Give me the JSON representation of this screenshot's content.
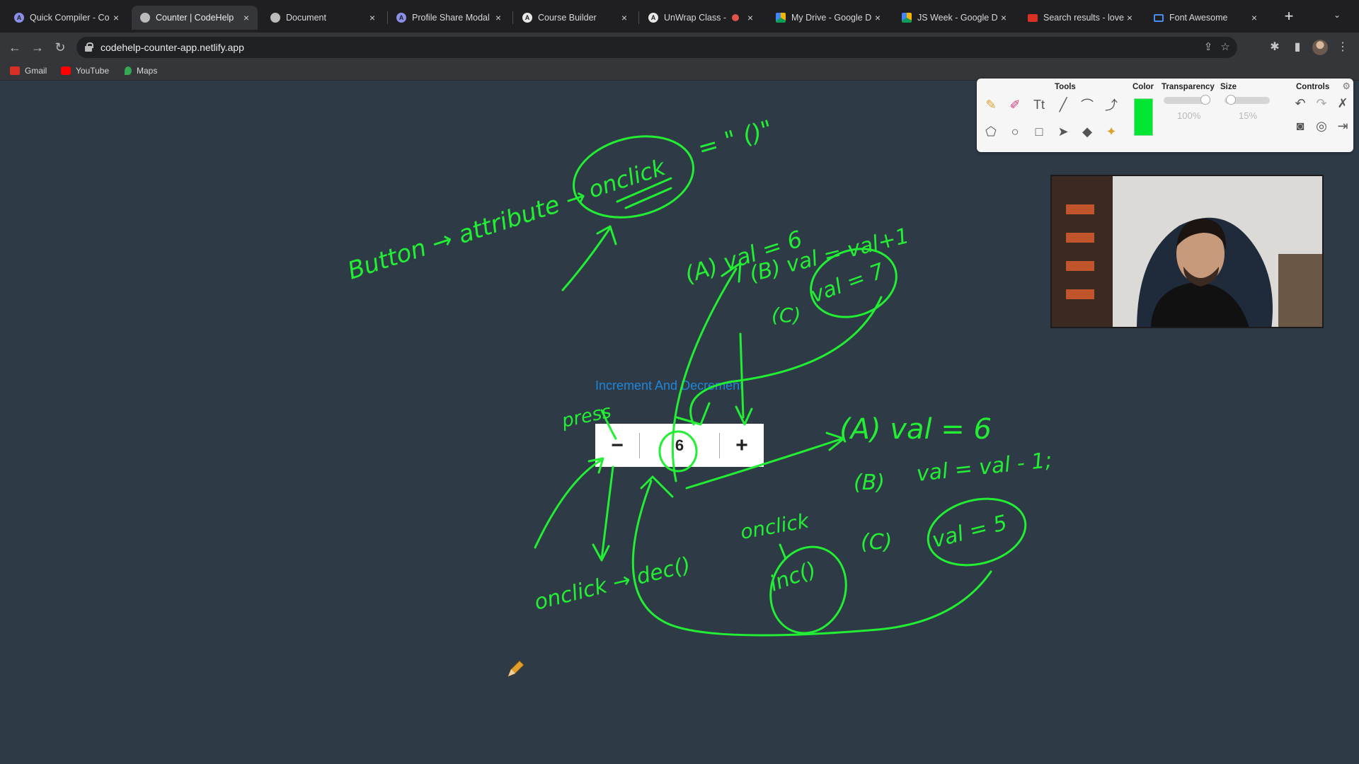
{
  "browser": {
    "tabs": [
      {
        "title": "Quick Compiler - Co",
        "icon": "codehelp-logo-icon",
        "active": false
      },
      {
        "title": "Counter | CodeHelp",
        "icon": "globe-icon",
        "active": true
      },
      {
        "title": "Document",
        "icon": "globe-icon",
        "active": false
      },
      {
        "title": "Profile Share Modal",
        "icon": "codehelp-logo-icon",
        "active": false
      },
      {
        "title": "Course Builder",
        "icon": "circle-logo-icon",
        "active": false
      },
      {
        "title": "UnWrap Class -",
        "icon": "circle-logo-icon",
        "active": false,
        "recording": true
      },
      {
        "title": "My Drive - Google D",
        "icon": "google-drive-icon",
        "active": false
      },
      {
        "title": "JS Week - Google D",
        "icon": "google-drive-icon",
        "active": false
      },
      {
        "title": "Search results - love",
        "icon": "gmail-icon",
        "active": false
      },
      {
        "title": "Font Awesome",
        "icon": "flag-icon",
        "active": false
      }
    ],
    "url": "codehelp-counter-app.netlify.app",
    "bookmarks": [
      {
        "label": "Gmail",
        "icon": "gmail-icon"
      },
      {
        "label": "YouTube",
        "icon": "youtube-icon"
      },
      {
        "label": "Maps",
        "icon": "maps-pin-icon"
      }
    ]
  },
  "page": {
    "heading": "Increment And Decrement",
    "counter": {
      "decrement_label": "−",
      "value": "6",
      "increment_label": "+"
    }
  },
  "annotation_tool": {
    "sections": {
      "tools": "Tools",
      "color": "Color",
      "transparency": "Transparency",
      "size": "Size",
      "controls": "Controls"
    },
    "selected_color": "#00e632",
    "transparency_value": "100%",
    "size_value": "15%"
  },
  "handwriting": {
    "button_attr": "Button → attribute →",
    "onclick_top": "onclick",
    "equals_quote": "= \" ()\"",
    "a_step": "(A) val = 6",
    "b_step": "(B) val = val+1",
    "c_step": "(C)",
    "val7": "val = 7",
    "press": "press",
    "a_right": "(A) val = 6",
    "b_right": "(B)",
    "b_right_expr": "val = val - 1;",
    "c_right": "(C)",
    "val5": "val = 5",
    "onclick_inc": "onclick",
    "inc_fn": "inc()",
    "onclick_dec": "onclick → dec()"
  },
  "colors": {
    "ink": "#22ee33",
    "page_bg": "#2f3a47",
    "heading": "#1f86d8"
  }
}
